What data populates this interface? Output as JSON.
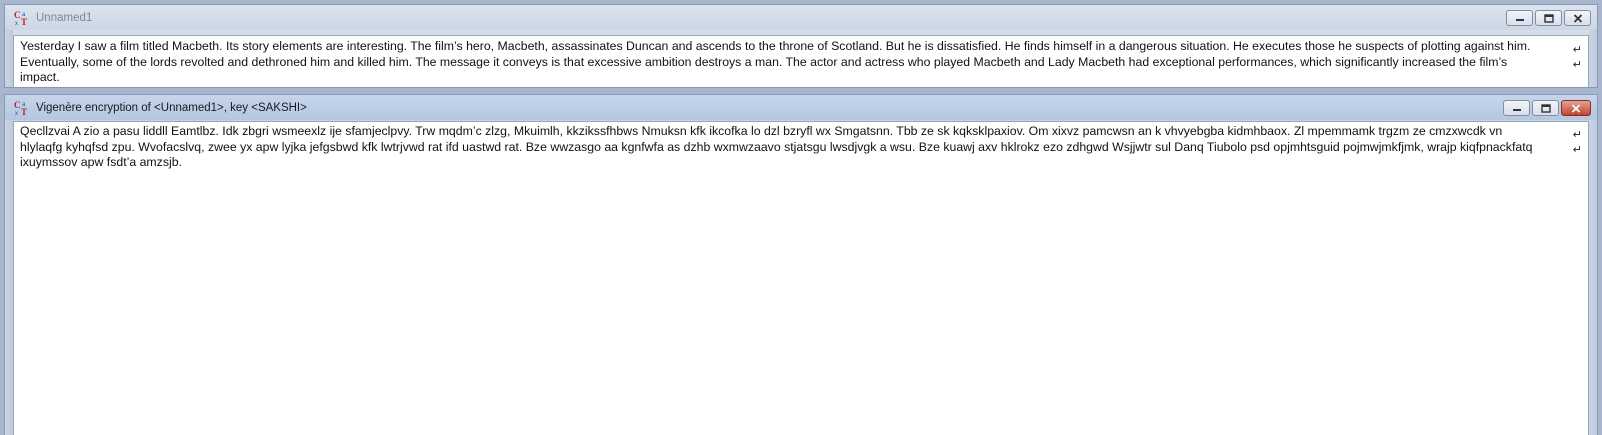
{
  "windows": {
    "plaintext": {
      "title": "Unnamed1",
      "icon": "cryptool-icon",
      "controls": {
        "minimize": "minimize-icon",
        "maximize": "restore-icon",
        "close": "close-icon"
      },
      "content": "Yesterday I saw a film titled Macbeth. Its story elements are interesting. The film’s hero, Macbeth, assassinates Duncan and ascends to the throne of Scotland. But he is dissatisfied. He finds himself in a dangerous situation. He executes those he suspects of plotting against him. Eventually, some of the lords revolted and dethroned him and killed him. The message it conveys is that excessive ambition destroys a man. The actor and actress who played Macbeth and Lady Macbeth had exceptional performances, which significantly increased the film’s impact."
    },
    "ciphertext": {
      "title": "Vigenère encryption of <Unnamed1>, key <SAKSHI>",
      "icon": "cryptool-icon",
      "controls": {
        "minimize": "minimize-icon",
        "maximize": "restore-icon",
        "close": "close-icon"
      },
      "content": "Qecllzvai A zio a pasu liddll Eamtlbz. Idk zbgri wsmeexlz ije sfamjeclpvy. Trw mqdm’c zlzg, Mkuimlh, kkzikssfhbws Nmuksn kfk ikcofka lo dzl bzryfl wx Smgatsnn. Tbb ze sk kqksklpaxiov. Om xixvz pamcwsn an k vhvyebgba kidmhbaox. Zl mpemmamk trgzm ze cmzxwcdk vn hlylaqfg kyhqfsd zpu. Wvofacslvq, zwee yx apw lyjka jefgsbwd kfk lwtrjvwd rat ifd uastwd rat. Bze wwzasgo aa kgnfwfa as dzhb wxmwzaavo stjatsgu lwsdjvgk a wsu. Bze kuawj axv hklrokz ezo zdhgwd Wsjjwtr sul Danq Tiubolo psd opjmhtsguid pojmwjmkfjmk, wrajp kiqfpnackfatq ixuymssov apw fsdt’a amzsjb."
    }
  },
  "colors": {
    "mdi_background": "#a7b6cc",
    "close_active": "#c6432c"
  }
}
